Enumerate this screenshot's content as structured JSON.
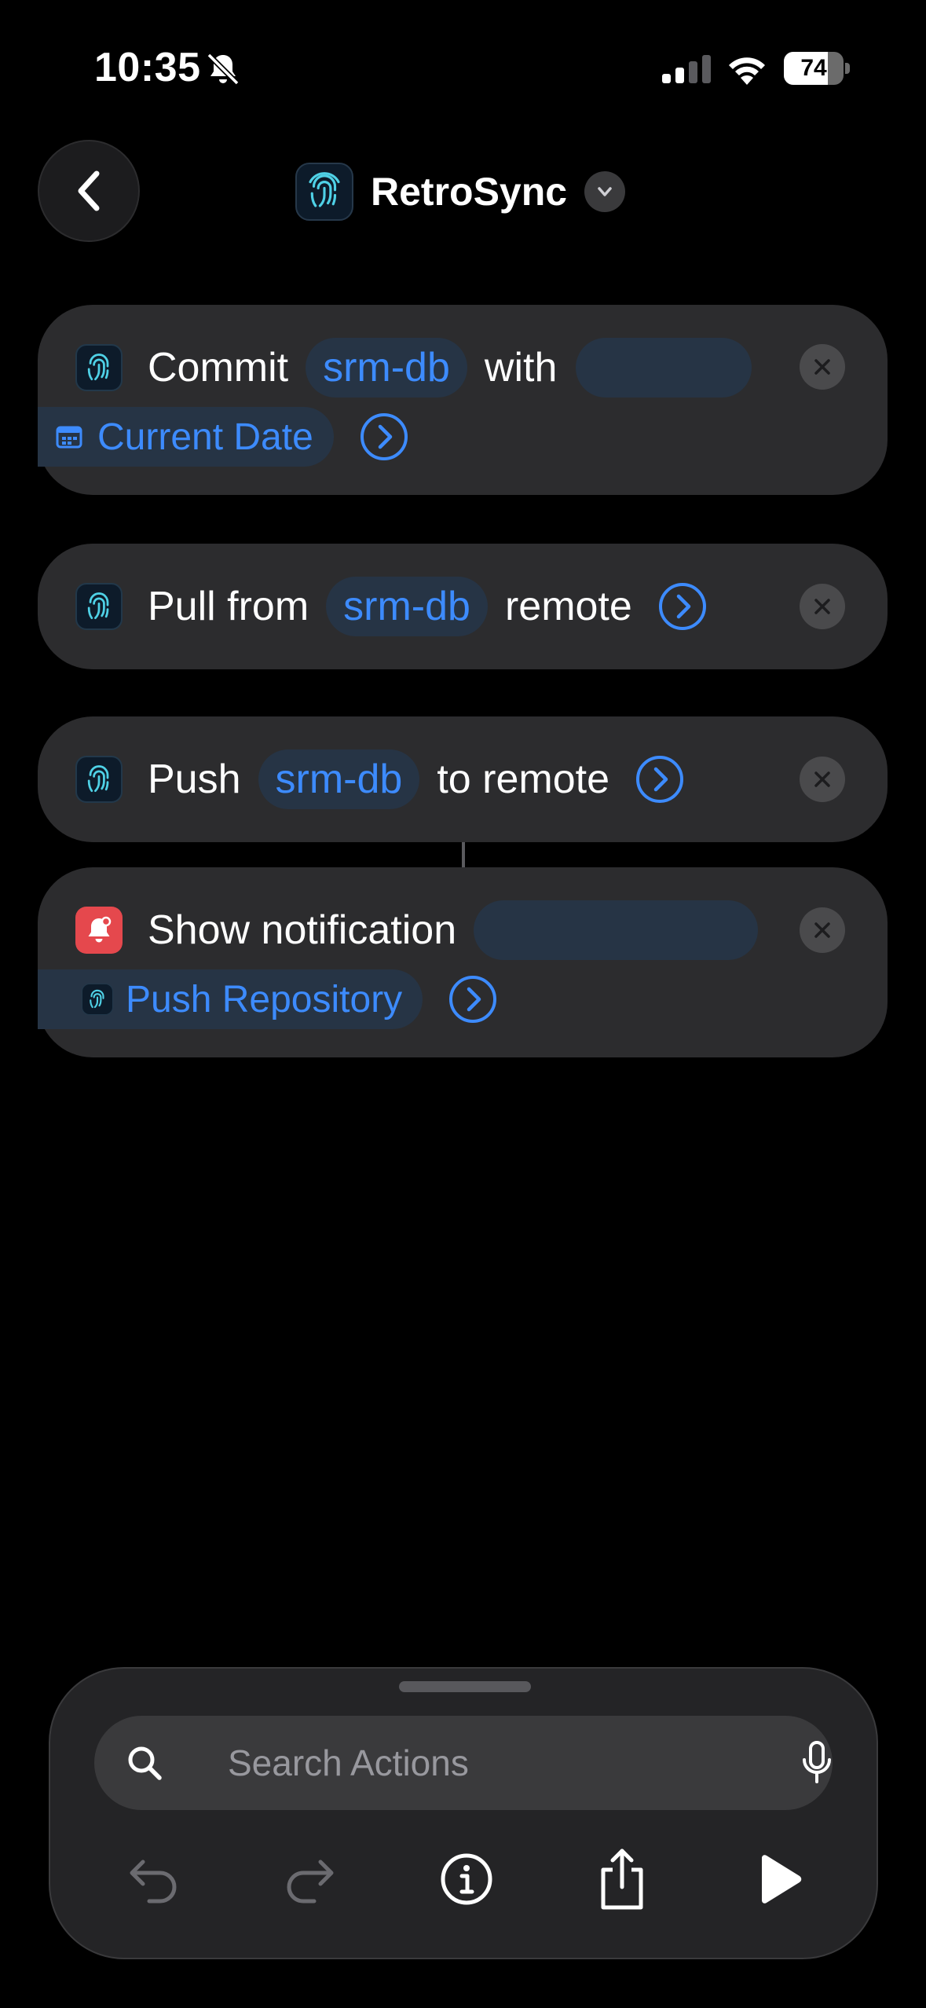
{
  "status_bar": {
    "time": "10:35",
    "battery_level": "74",
    "battery_fraction": 0.74
  },
  "nav": {
    "title": "RetroSync",
    "app_icon": "fingerprint-icon"
  },
  "actions": [
    {
      "verb": "Commit",
      "repo": "srm-db",
      "connector": "with",
      "variable": "Current Date",
      "variable_icon": "calendar-icon"
    },
    {
      "verb": "Pull from",
      "repo": "srm-db",
      "connector": "remote"
    },
    {
      "verb": "Push",
      "repo": "srm-db",
      "connector": "to remote"
    },
    {
      "verb": "Show notification",
      "variable": "Push Repository",
      "variable_icon": "fingerprint-icon",
      "app_icon": "notification-bell-icon"
    }
  ],
  "bottom_sheet": {
    "search_placeholder": "Search Actions",
    "toolbar": [
      "undo-icon",
      "redo-icon",
      "info-icon",
      "share-icon",
      "play-icon"
    ]
  },
  "colors": {
    "accent_blue": "#3d8bfd",
    "card_bg": "#2c2c2e",
    "token_bg": "#263445",
    "notification_red": "#e5484d"
  }
}
